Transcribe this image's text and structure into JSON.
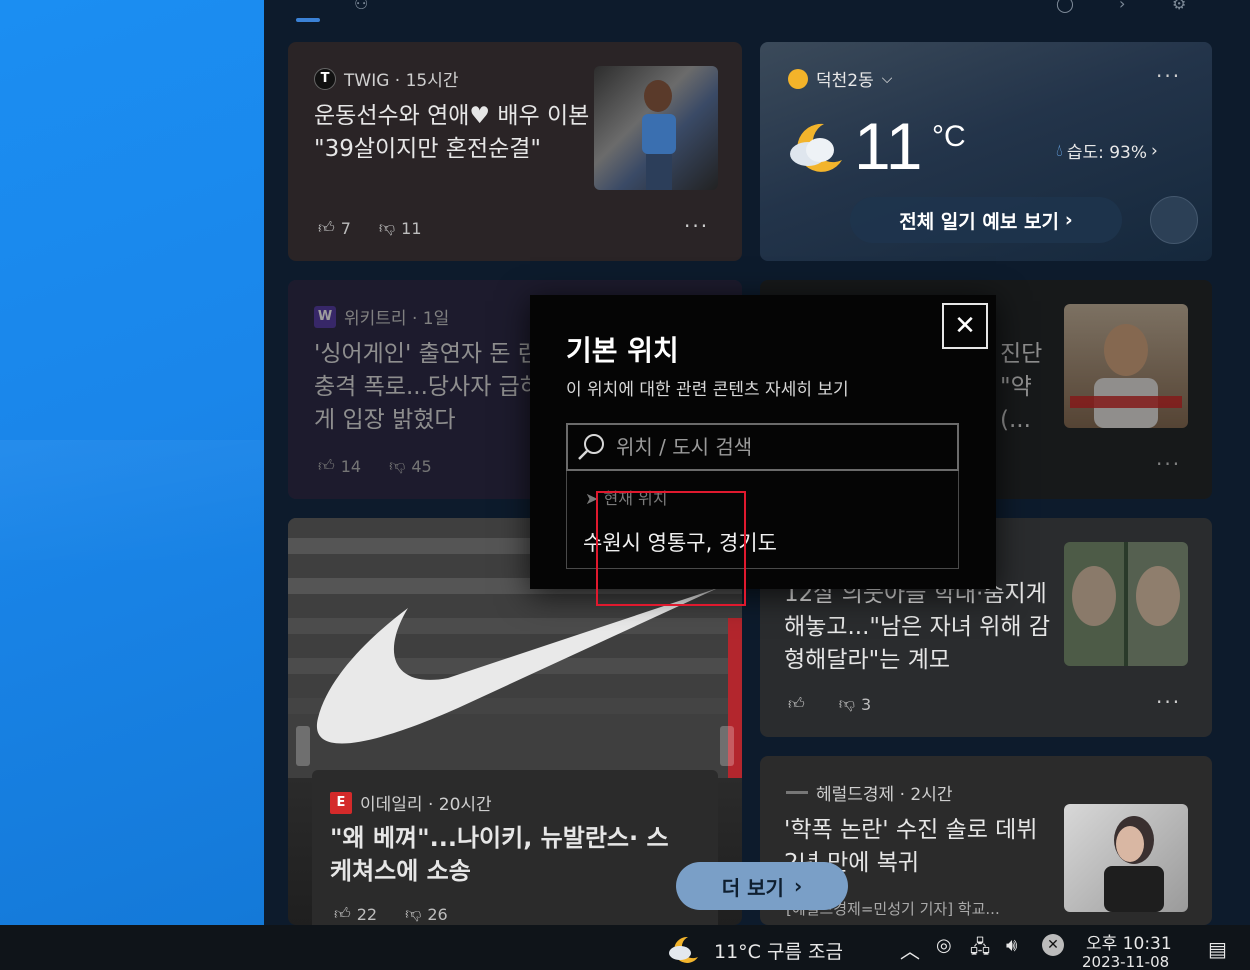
{
  "feed": {
    "cards": [
      {
        "source": "TWIG · 15시간",
        "headline": "운동선수와 연애♥ 배우 이본 \"39살이지만 혼전순결\"",
        "likes": "7",
        "dislikes": "11"
      },
      {
        "source": "위키트리 · 1일",
        "headline": "'싱어게인' 출연자 돈 련 충격 폭로...당사자 급하게 입장 밝혔다",
        "likes": "14",
        "dislikes": "45"
      },
      {
        "source": "이데일리 · 20시간",
        "headline": "\"왜 베껴\"...나이키, 뉴발란스· 스케쳐스에 소송",
        "likes": "22",
        "dislikes": "26"
      },
      {
        "headline_line1": "진단",
        "headline_line2": "\"약",
        "headline_line3": "(..."
      },
      {
        "headline": "12살 의붓아들 학대·숨지게 해놓고...\"남은 자녀 위해 감형해달라\"는 계모",
        "likes": "",
        "dislikes": "3"
      },
      {
        "source": "헤럴드경제 · 2시간",
        "headline": "'학폭 논란' 수진 솔로 데뷔 2년 만에 복귀",
        "snippet": "[헤럴드경제=민성기 기자] 학교..."
      }
    ]
  },
  "weather": {
    "location": "덕천2동",
    "temperature": "11",
    "unit": "°C",
    "humidity": "습도: 93%",
    "forecast_button": "전체 일기 예보 보기"
  },
  "modal": {
    "title": "기본 위치",
    "subtitle": "이 위치에 대한 관련 콘텐츠 자세히 보기",
    "search_placeholder": "위치 / 도시 검색",
    "current_location_label": "현재 위치",
    "result": "수원시 영통구, 경기도"
  },
  "more_button": "더 보기",
  "taskbar": {
    "weather": "11°C 구름 조금",
    "time": "오후 10:31",
    "date": "2023-11-08"
  },
  "colors": {
    "highlight": "#e0192e",
    "more_button": "#7a9fc7"
  }
}
